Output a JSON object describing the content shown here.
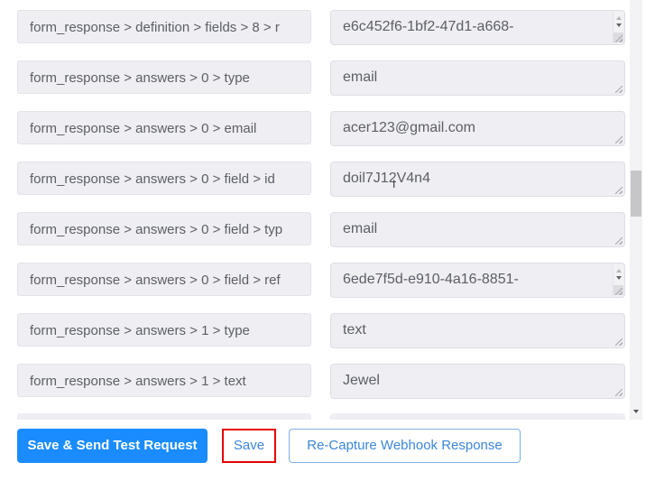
{
  "fields": [
    {
      "key": "form_response > definition > fields > 8 > r",
      "value": "e6c452f6-1bf2-47d1-a668-",
      "multiline": true
    },
    {
      "key": "form_response > answers > 0 > type",
      "value": "email",
      "multiline": false
    },
    {
      "key": "form_response > answers > 0 > email",
      "value": "acer123@gmail.com",
      "multiline": false
    },
    {
      "key": "form_response > answers > 0 > field > id",
      "value": "doil7J12V4n4",
      "multiline": false
    },
    {
      "key": "form_response > answers > 0 > field > typ",
      "value": "email",
      "multiline": false
    },
    {
      "key": "form_response > answers > 0 > field > ref",
      "value": "6ede7f5d-e910-4a16-8851-",
      "multiline": true
    },
    {
      "key": "form_response > answers > 1 > type",
      "value": "text",
      "multiline": false
    },
    {
      "key": "form_response > answers > 1 > text",
      "value": "Jewel",
      "multiline": false
    }
  ],
  "footer": {
    "primary_button": "Save & Send Test Request",
    "save_button": "Save",
    "recapture_button": "Re-Capture Webhook Response"
  },
  "colors": {
    "primary": "#1a8cff",
    "link_text": "#3d86d6",
    "highlight": "#e60000",
    "field_bg": "#eeeef3"
  }
}
